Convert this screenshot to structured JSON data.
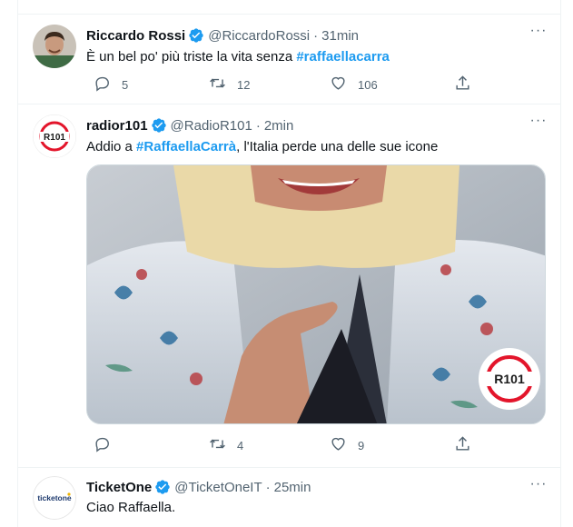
{
  "tweets": [
    {
      "name": "Riccardo Rossi",
      "handle": "@RiccardoRossi",
      "dot": "·",
      "time": "31min",
      "text_before": "È un bel po' più triste la vita senza ",
      "hashtag": "#raffaellacarra",
      "text_after": "",
      "replies": "5",
      "retweets": "12",
      "likes": "106",
      "verified": true,
      "avatar": "photo-person"
    },
    {
      "name": "radior101",
      "handle": "@RadioR101",
      "dot": "·",
      "time": "2min",
      "text_before": "Addio a ",
      "hashtag": "#RaffaellaCarrà",
      "text_after": ", l'Italia perde una delle sue icone",
      "replies": "",
      "retweets": "4",
      "likes": "9",
      "verified": true,
      "avatar": "r101-logo",
      "avatar_logo_text": "R101",
      "media_watermark_text": "R101"
    },
    {
      "name": "TicketOne",
      "handle": "@TicketOneIT",
      "dot": "·",
      "time": "25min",
      "text_before": "Ciao Raffaella.",
      "hashtag": "",
      "text_after": "",
      "verified": true,
      "avatar": "ticketone-logo",
      "avatar_logo_text": "ticketone"
    }
  ],
  "more_glyph": "···",
  "colors": {
    "accent": "#1d9bf0",
    "muted": "#536471",
    "text": "#0f1419",
    "border": "#eff3f4",
    "r101_red": "#e3152b"
  }
}
